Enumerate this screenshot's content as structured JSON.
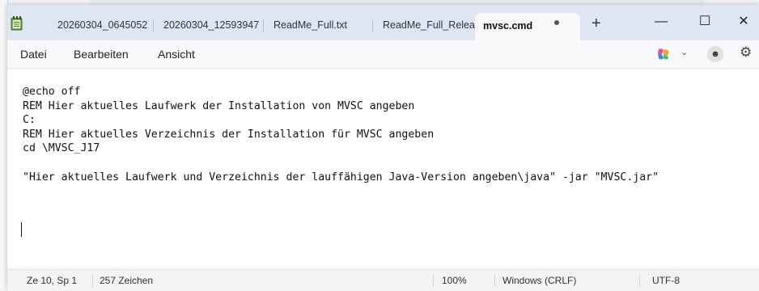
{
  "colors": {
    "titlebar": "#dfe6f3",
    "editor_bg": "#ffffff",
    "accent_icon": "#4a7f2c"
  },
  "tabs": [
    {
      "label": "20260304_0645052",
      "active": false
    },
    {
      "label": "20260304_12593947",
      "active": false
    },
    {
      "label": "ReadMe_Full.txt",
      "active": false
    },
    {
      "label": "ReadMe_Full_Releas",
      "active": false
    },
    {
      "label": "mvsc.cmd",
      "active": true,
      "modified": true
    }
  ],
  "new_tab_label": "+",
  "window_controls": {
    "minimize": "—",
    "maximize": "☐",
    "close": "✕"
  },
  "menu": {
    "file": "Datei",
    "edit": "Bearbeiten",
    "view": "Ansicht"
  },
  "toolbar_right": {
    "copilot_icon": "copilot-icon",
    "profile_icon": "profile-icon",
    "settings_icon": "gear-icon"
  },
  "editor": {
    "lines": [
      "@echo off",
      "REM Hier aktuelles Laufwerk der Installation von MVSC angeben",
      "C:",
      "REM Hier aktuelles Verzeichnis der Installation für MVSC angeben",
      "cd \\MVSC_J17",
      "",
      "\"Hier aktuelles Laufwerk und Verzeichnis der lauffähigen Java-Version angeben\\java\" -jar \"MVSC.jar\"",
      "",
      "",
      ""
    ]
  },
  "status": {
    "position": "Ze 10, Sp 1",
    "chars": "257 Zeichen",
    "zoom": "100%",
    "line_ending": "Windows (CRLF)",
    "encoding": "UTF-8"
  }
}
